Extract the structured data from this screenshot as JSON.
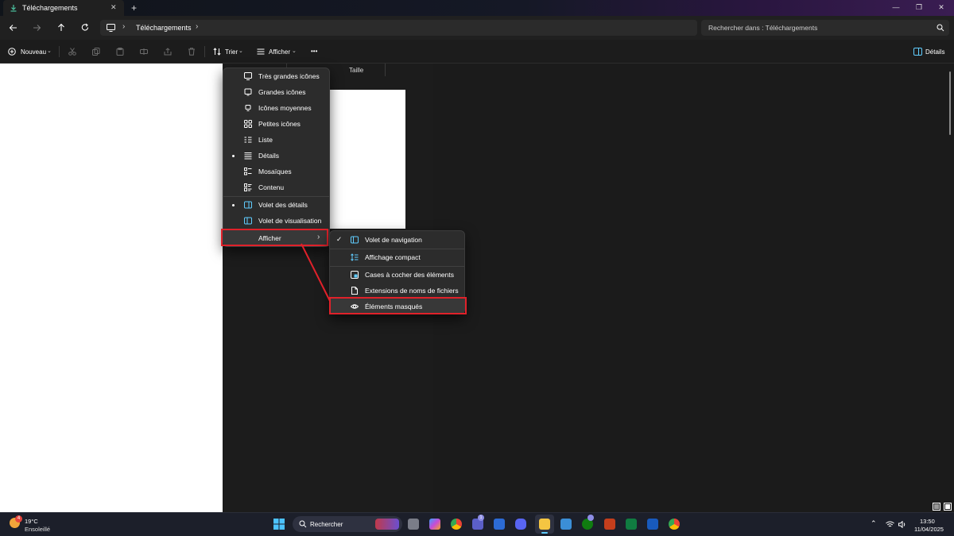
{
  "window": {
    "tab_title": "Téléchargements",
    "new_tab": "+",
    "controls": {
      "minimize": "—",
      "maximize": "❐",
      "close": "✕"
    }
  },
  "address": {
    "location": "Téléchargements",
    "search_placeholder": "Rechercher dans : Téléchargements"
  },
  "toolbar": {
    "new_label": "Nouveau",
    "sort_label": "Trier",
    "view_label": "Afficher",
    "more_label": "•••",
    "details_label": "Détails"
  },
  "columns": {
    "size": "Taille"
  },
  "view_menu": {
    "items": [
      {
        "label": "Très grandes icônes",
        "icon": "monitor-icon",
        "selected": false
      },
      {
        "label": "Grandes icônes",
        "icon": "monitor-icon",
        "selected": false
      },
      {
        "label": "Icônes moyennes",
        "icon": "small-monitor-icon",
        "selected": false
      },
      {
        "label": "Petites icônes",
        "icon": "grid-icon",
        "selected": false
      },
      {
        "label": "Liste",
        "icon": "list-icon",
        "selected": false
      },
      {
        "label": "Détails",
        "icon": "details-icon",
        "selected": true
      },
      {
        "label": "Mosaïques",
        "icon": "tiles-icon",
        "selected": false
      },
      {
        "label": "Contenu",
        "icon": "content-icon",
        "selected": false
      }
    ],
    "panes": [
      {
        "label": "Volet des détails",
        "icon": "details-pane-icon",
        "selected": true
      },
      {
        "label": "Volet de visualisation",
        "icon": "preview-pane-icon",
        "selected": false
      }
    ],
    "show_label": "Afficher",
    "chevron": "›"
  },
  "show_submenu": {
    "items": [
      {
        "label": "Volet de navigation",
        "icon": "navigation-pane-icon",
        "checked": true
      },
      {
        "label": "Affichage compact",
        "icon": "compact-view-icon",
        "checked": false
      },
      {
        "label": "Cases à cocher des éléments",
        "icon": "checkbox-icon",
        "checked": false
      },
      {
        "label": "Extensions de noms de fichiers",
        "icon": "file-icon",
        "checked": false
      },
      {
        "label": "Éléments masqués",
        "icon": "eye-icon",
        "checked": false
      }
    ],
    "check_glyph": "✓"
  },
  "taskbar": {
    "weather_temp": "19°C",
    "weather_desc": "Ensoleillé",
    "weather_badge": "4",
    "search_label": "Rechercher",
    "teams_badge": "1",
    "time": "13:50",
    "date": "11/04/2025"
  },
  "colors": {
    "accent": "#60cdff",
    "highlight_box": "#e0212a",
    "menu_bg": "#2c2c2c"
  }
}
